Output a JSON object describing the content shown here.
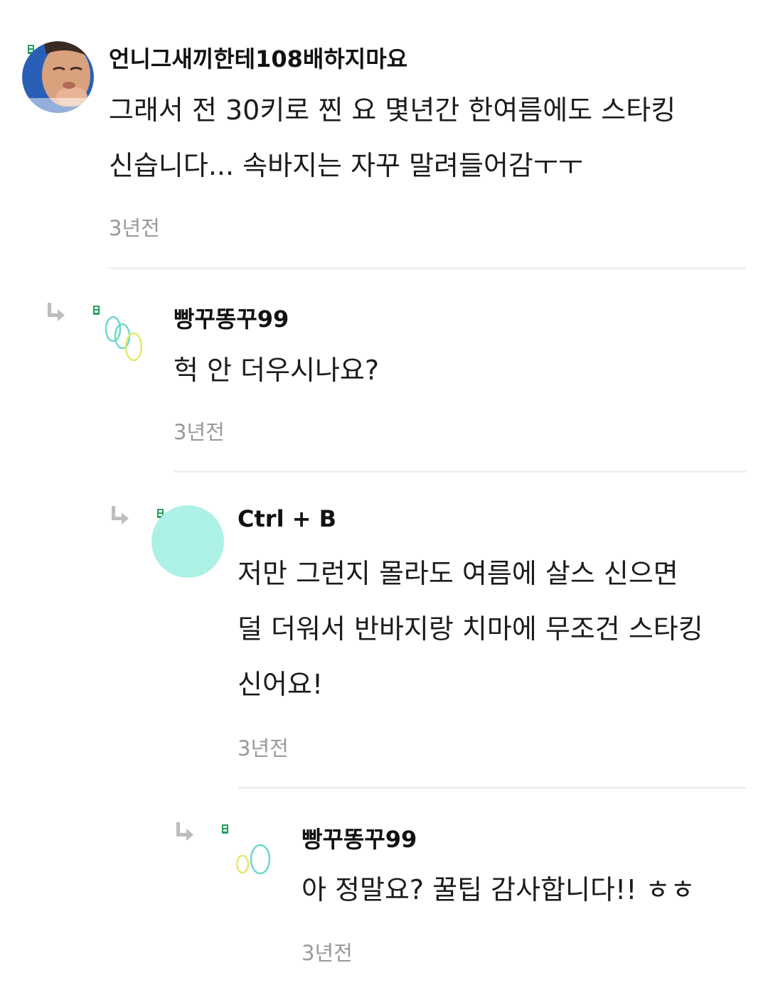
{
  "comments": [
    {
      "author": "언니그새끼한테108배하지마요",
      "text_lines": [
        "그래서 전 30키로 찐 요 몇년간 한여름에도 스타킹",
        "신습니다... 속바지는 자꾸 말려들어감ㅜㅜ"
      ],
      "time": "3년전",
      "avatar": "user-photo-avatar",
      "is_reply": false
    },
    {
      "author": "빵꾸똥꾸99",
      "text_lines": [
        "헉 안 더우시나요?"
      ],
      "time": "3년전",
      "avatar": "rings-avatar",
      "is_reply": true
    },
    {
      "author": "Ctrl + B",
      "text_lines": [
        "저만 그런지 몰라도 여름에 살스 신으면",
        "덜 더워서 반바지랑 치마에 무조건 스타킹",
        "신어요!"
      ],
      "time": "3년전",
      "avatar": "mint-circle-avatar",
      "is_reply": true
    },
    {
      "author": "빵꾸똥꾸99",
      "text_lines": [
        "아 정말요? 꿀팁 감사합니다!! ㅎㅎ"
      ],
      "time": "3년전",
      "avatar": "small-rings-avatar",
      "is_reply": true
    }
  ],
  "colors": {
    "badge": "#1fa05a",
    "mint_avatar": "#adf0e6",
    "divider": "#eeeeee",
    "timestamp": "#999999"
  }
}
